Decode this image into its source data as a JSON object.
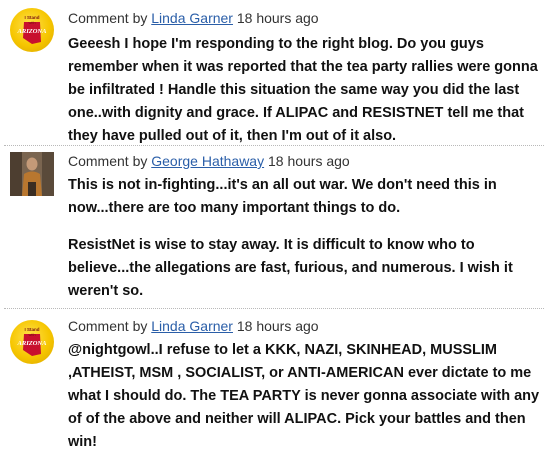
{
  "comments": [
    {
      "prefix": "Comment by",
      "author": "Linda Garner",
      "time": "18 hours ago",
      "avatar_text": [
        "I Stand",
        "with",
        "ARIZONA"
      ],
      "paragraphs": [
        "Geeesh I hope I'm responding to the right blog. Do you guys remember when it was reported that the tea party rallies were gonna be infiltrated ! Handle this situation the same way you did the last one..with dignity and grace. If ALIPAC and RESISTNET tell me that they have pulled out of it, then I'm out of it also."
      ]
    },
    {
      "prefix": "Comment by",
      "author": "George Hathaway",
      "time": "18 hours ago",
      "paragraphs": [
        "This is not in-fighting...it's an all out war. We don't need this in now...there are too many important things to do.",
        "ResistNet is wise to stay away. It is difficult to know who to believe...the allegations are fast, furious, and numerous. I wish it weren't so."
      ]
    },
    {
      "prefix": "Comment by",
      "author": "Linda Garner",
      "time": "18 hours ago",
      "avatar_text": [
        "I Stand",
        "with",
        "ARIZONA"
      ],
      "paragraphs": [
        "@nightgowl..I refuse to let a KKK, NAZI, SKINHEAD, MUSSLIM ,ATHEIST, MSM , SOCIALIST, or ANTI-AMERICAN ever dictate to me what I should do. The TEA PARTY is never gonna associate with any of of the above and neither will ALIPAC. Pick your battles and then win!"
      ]
    }
  ],
  "colors": {
    "link": "#2a5ea8",
    "badge_yellow": "#f6c600",
    "badge_red": "#c8102e"
  }
}
